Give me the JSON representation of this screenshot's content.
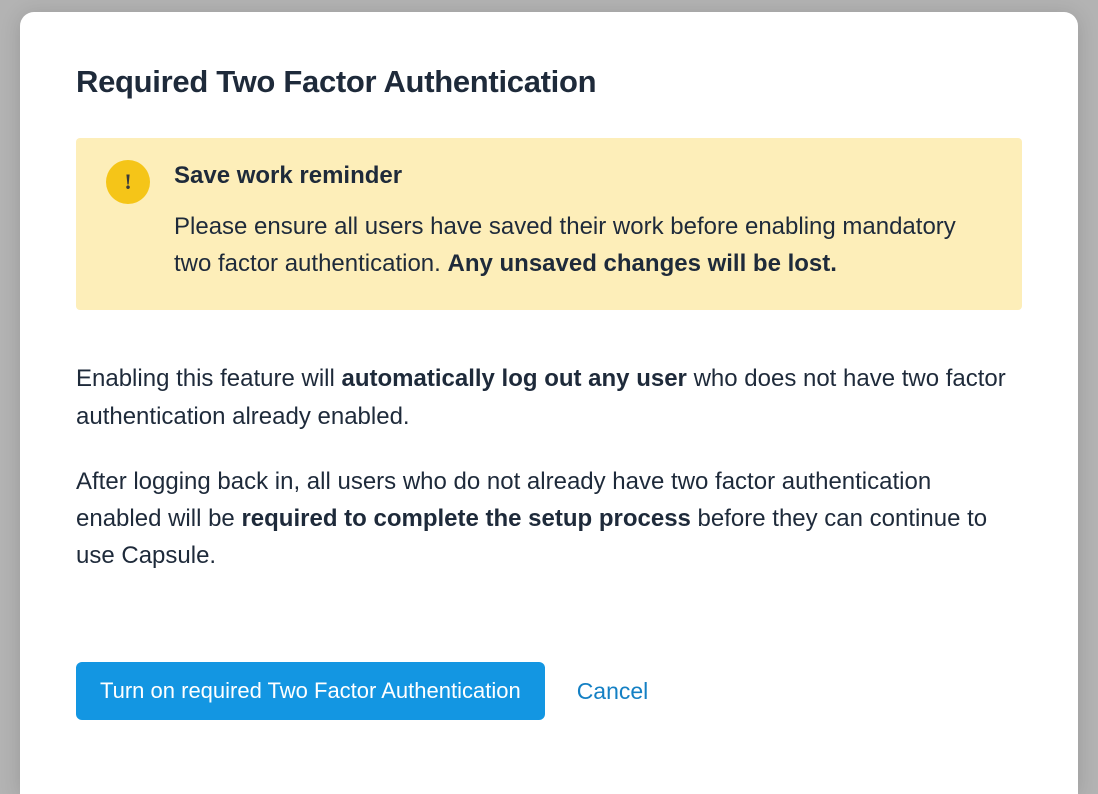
{
  "modal": {
    "title": "Required Two Factor Authentication",
    "alert": {
      "title": "Save work reminder",
      "body_prefix": "Please ensure all users have saved their work before enabling mandatory two factor authentication. ",
      "body_bold": "Any unsaved changes will be lost."
    },
    "paragraph1": {
      "prefix": "Enabling this feature will ",
      "bold": "automatically log out any user",
      "suffix": " who does not have two factor authentication already enabled."
    },
    "paragraph2": {
      "prefix": "After logging back in, all users who do not already have two factor authentication enabled will be ",
      "bold": "required to complete the setup process",
      "suffix": " before they can continue to use Capsule."
    },
    "actions": {
      "confirm": "Turn on required Two Factor Authentication",
      "cancel": "Cancel"
    }
  }
}
